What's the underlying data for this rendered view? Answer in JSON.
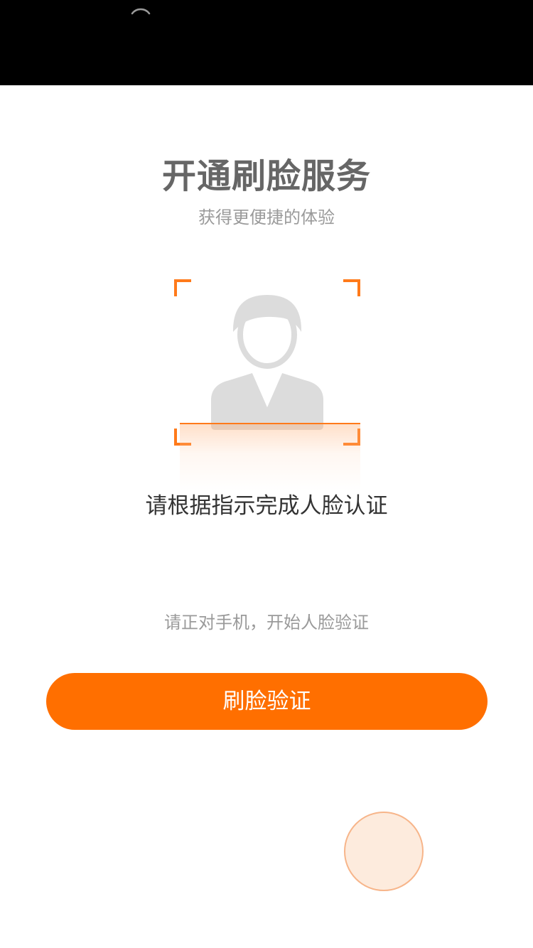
{
  "header": {
    "loading_icon": "loading-arc-icon"
  },
  "main": {
    "title": "开通刷脸服务",
    "subtitle": "获得更便捷的体验",
    "instruction": "请根据指示完成人脸认证",
    "hint": "请正对手机，开始人脸验证",
    "verify_button_label": "刷脸验证"
  },
  "colors": {
    "accent": "#ff6f00",
    "top_bar": "#000000",
    "title_text": "#666666",
    "secondary_text": "#9a9a9a",
    "avatar_gray": "#dcdcdc"
  },
  "icons": {
    "scan_corners": "scan-frame-corners-icon",
    "avatar": "user-silhouette-icon",
    "floating": "floating-circle-button"
  }
}
